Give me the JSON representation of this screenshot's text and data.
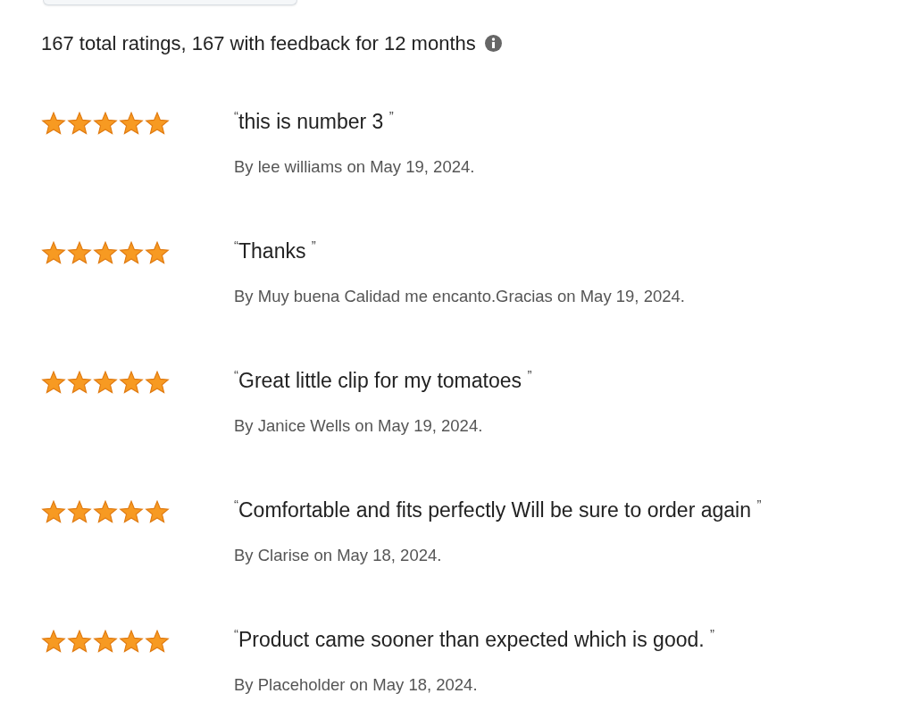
{
  "summary": "167 total ratings, 167 with feedback for 12 months",
  "reviews": [
    {
      "stars": 5,
      "title": "$^{“}$this is number 3 $^{”}$",
      "byline": "By lee williams on May 19, 2024."
    },
    {
      "stars": 5,
      "title": "$^{“}$Thanks $^{”}$",
      "byline": "By Muy buena Calidad me encanto.Gracias on May 19, 2024."
    },
    {
      "stars": 5,
      "title": "$^{“}$Great little clip for my tomatoes $^{”}$",
      "byline": "By Janice Wells on May 19, 2024."
    },
    {
      "stars": 5,
      "title": "$^{“}$Comfortable and fits perfectly Will be sure to order again $^{”}$",
      "byline": "By Clarise on May 18, 2024."
    },
    {
      "stars": 5,
      "title": "$^{“}$Product came sooner than expected which is good. $^{”}$",
      "byline": "By Placeholder on May 18, 2024."
    }
  ]
}
